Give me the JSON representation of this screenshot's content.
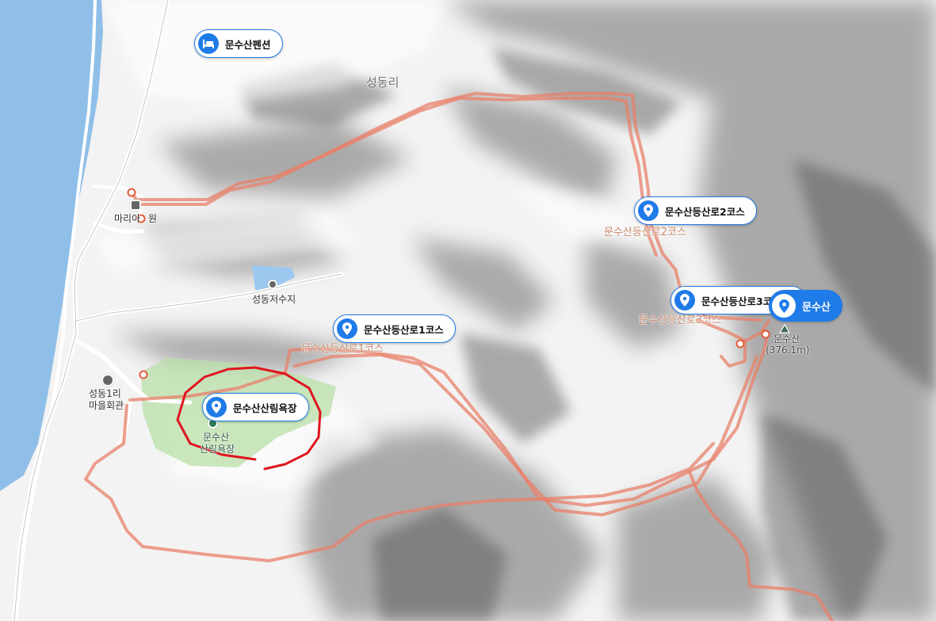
{
  "map": {
    "region_label": "성동리",
    "places": {
      "reservoir": "성동저수지",
      "village_hall_line1": "성동1리",
      "village_hall_line2": "마을회관",
      "inn": "마리아",
      "inn_suffix": "원",
      "forest_line1": "문수산",
      "forest_line2": "산림욕장"
    },
    "peak": {
      "name": "문수산",
      "elevation": "(376.1m)"
    },
    "trail_labels": {
      "course1": "문수산등산로1코스",
      "course2": "문수산등산로2코스",
      "course3": "문수산등산로3코스"
    },
    "markers": [
      {
        "label": "문수산펜션",
        "icon": "bed-icon"
      },
      {
        "label": "문수산등산로2코스",
        "icon": "location-pin-icon"
      },
      {
        "label": "문수산등산로3코스",
        "icon": "location-pin-icon"
      },
      {
        "label": "문수산",
        "icon": "location-pin-icon",
        "active": true
      },
      {
        "label": "문수산등산로1코스",
        "icon": "location-pin-icon"
      },
      {
        "label": "문수산산림욕장",
        "icon": "location-pin-icon"
      }
    ]
  },
  "colors": {
    "sea": "#8fbfe8",
    "trail": "#e8806a",
    "marker_blue": "#1f7be8",
    "forest_green": "#b9dfa8",
    "annotation_red": "#e0141e"
  }
}
